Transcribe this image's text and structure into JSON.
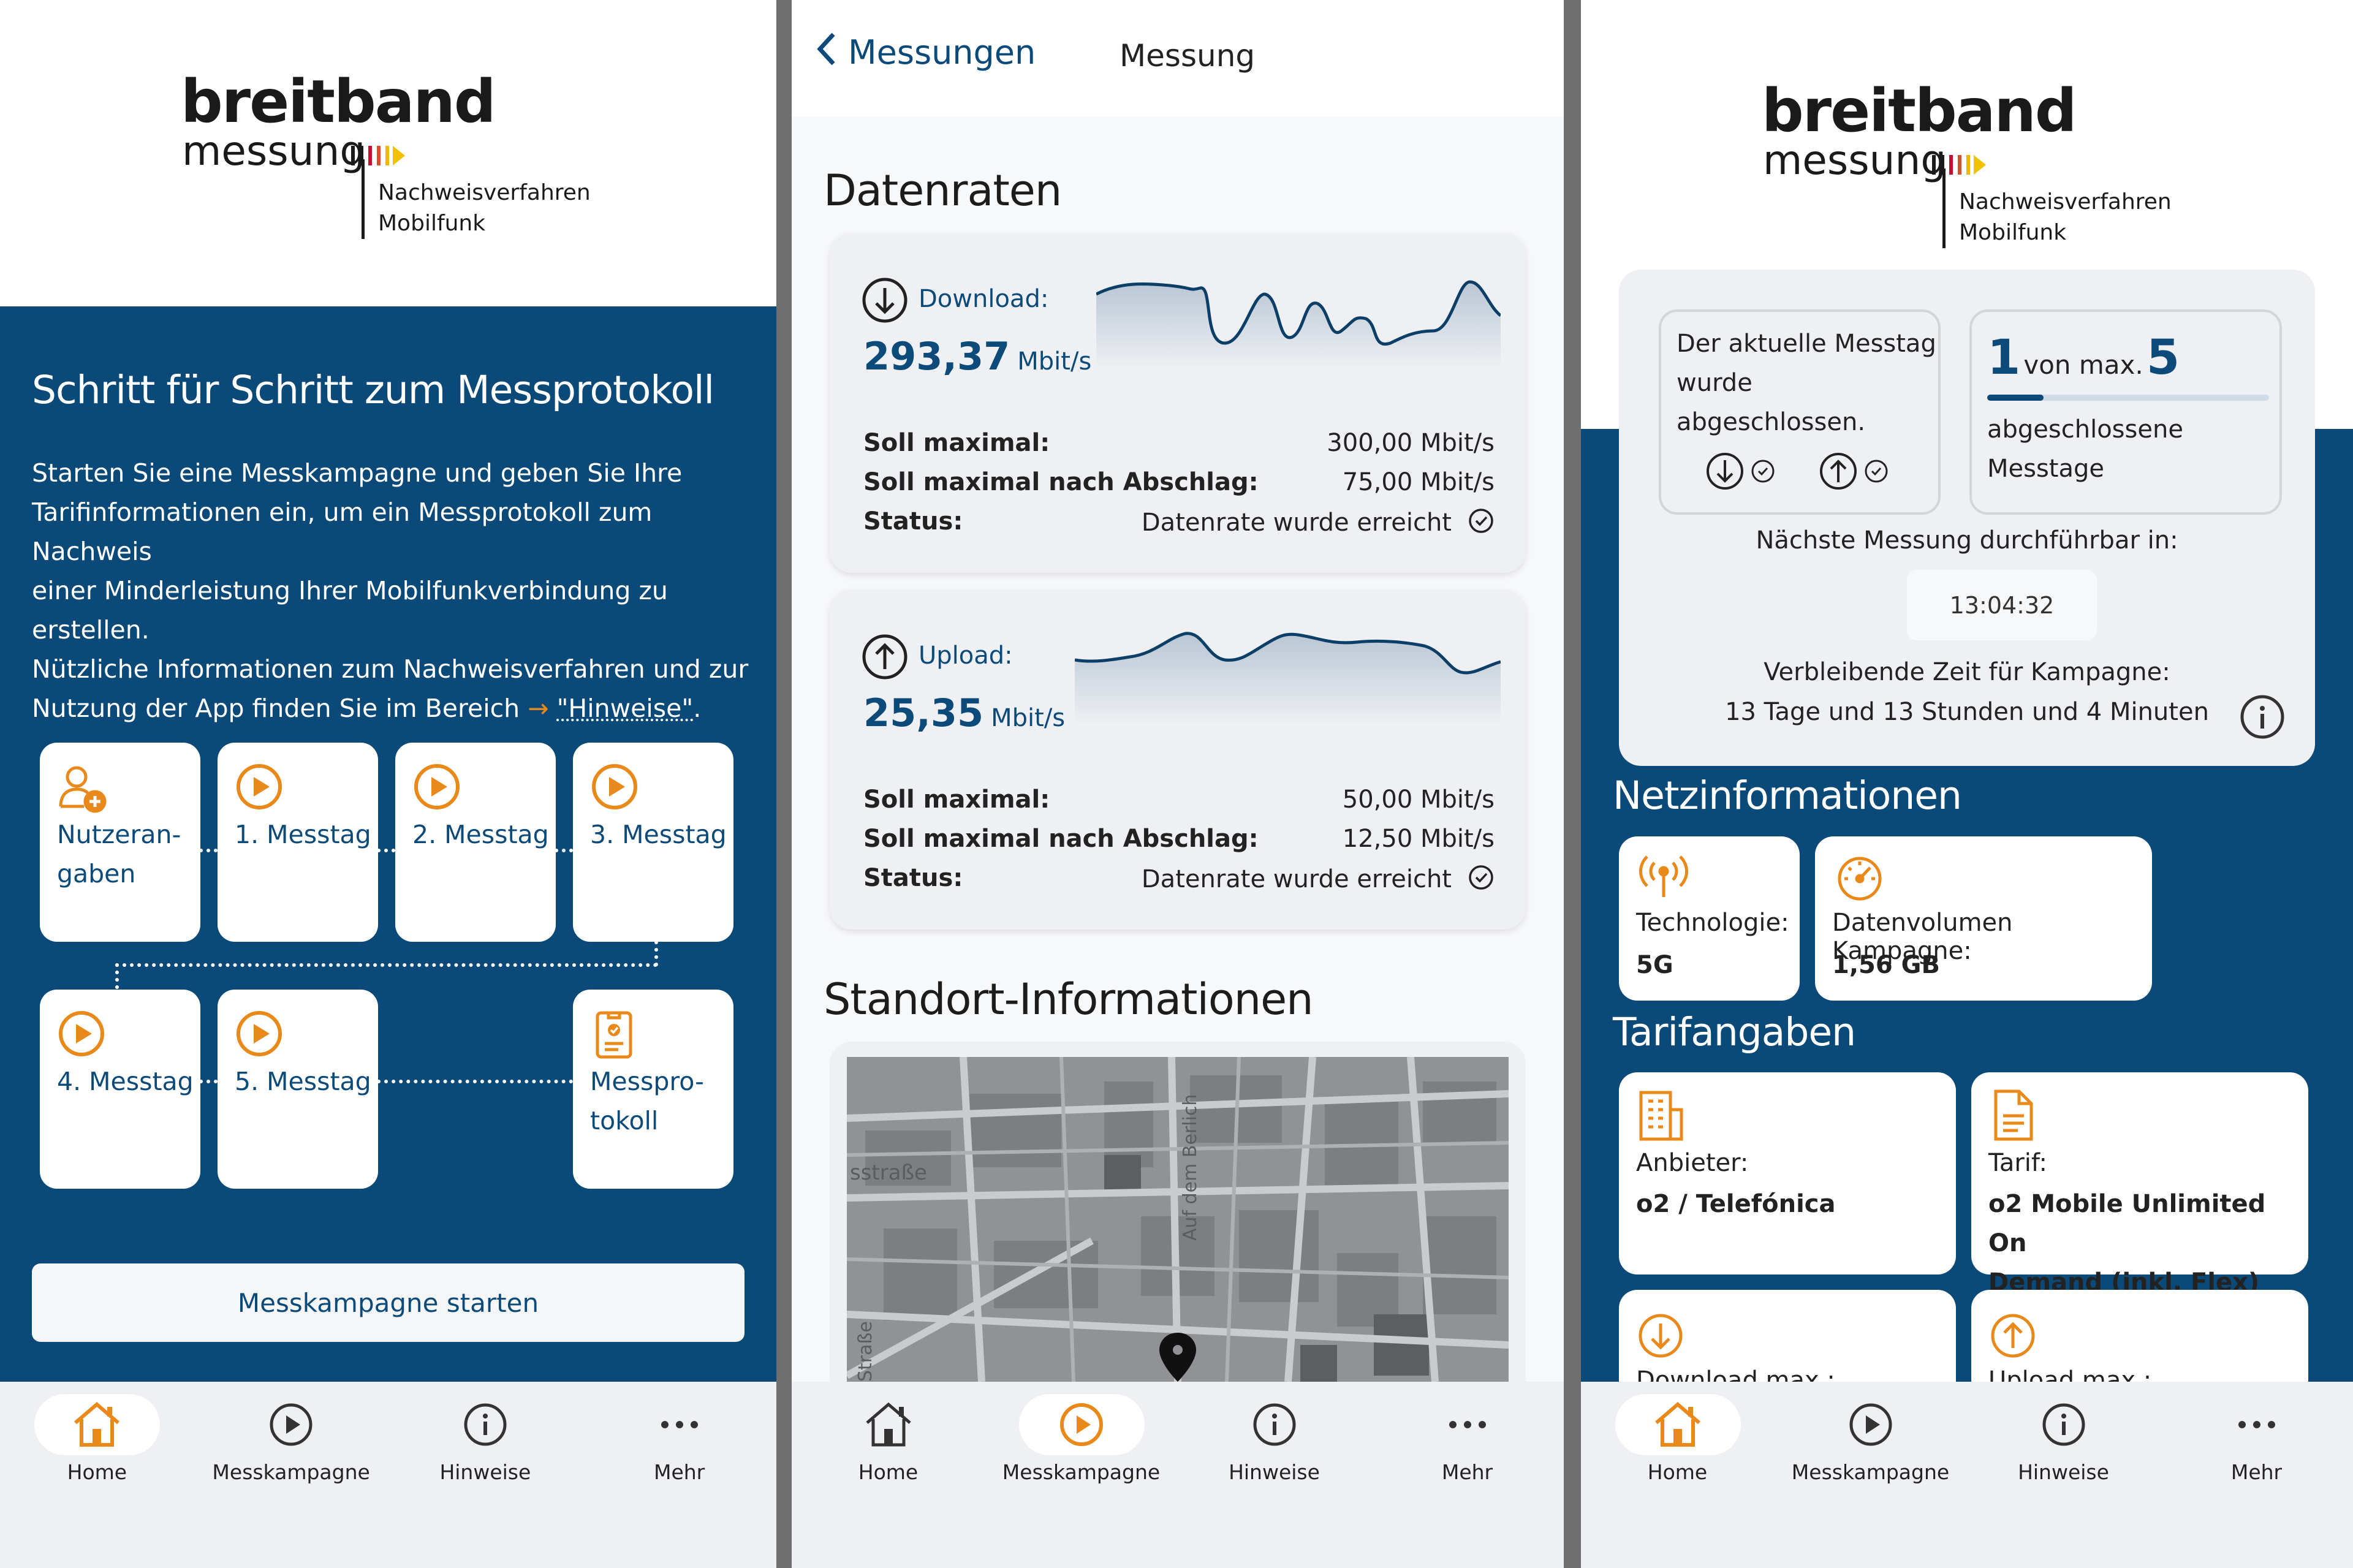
{
  "colors": {
    "navy": "#0b4a78",
    "accent_orange": "#e8891a",
    "card_gray": "#eef0f3"
  },
  "logo": {
    "word_top": "breitband",
    "word_bottom": "messung",
    "sub_line1": "Nachweisverfahren",
    "sub_line2": "Mobilfunk"
  },
  "screen1": {
    "title": "Schritt für Schritt zum Messprotokoll",
    "intro_lines": [
      "Starten Sie eine Messkampagne und geben Sie Ihre",
      "Tarifinformationen ein, um ein Messprotokoll zum Nachweis",
      "einer Minderleistung Ihrer Mobilfunkverbindung zu",
      "erstellen.",
      "Nützliche Informationen zum Nachweisverfahren und zur"
    ],
    "intro_last_prefix": "Nutzung der App finden Sie im Bereich ",
    "intro_arrow": "→",
    "intro_link": "\"Hinweise\"",
    "intro_last_suffix": ".",
    "steps": {
      "user_line1": "Nutzeran-",
      "user_line2": "gaben",
      "day1": "1. Messtag",
      "day2": "2. Messtag",
      "day3": "3. Messtag",
      "day4": "4. Messtag",
      "day5": "5. Messtag",
      "protocol_line1": "Messpro-",
      "protocol_line2": "tokoll"
    },
    "start_button": "Messkampagne starten"
  },
  "screen2": {
    "back_label": "Messungen",
    "header_title": "Messung",
    "section_rates": "Datenraten",
    "download": {
      "label": "Download:",
      "value": "293,37",
      "unit": "Mbit/s",
      "soll_max_label": "Soll maximal:",
      "soll_max_value": "300,00 Mbit/s",
      "soll_abschlag_label": "Soll maximal nach Abschlag:",
      "soll_abschlag_value": "75,00 Mbit/s",
      "status_label": "Status:",
      "status_value": "Datenrate wurde erreicht"
    },
    "upload": {
      "label": "Upload:",
      "value": "25,35",
      "unit": "Mbit/s",
      "soll_max_label": "Soll maximal:",
      "soll_max_value": "50,00 Mbit/s",
      "soll_abschlag_label": "Soll maximal nach Abschlag:",
      "soll_abschlag_value": "12,50 Mbit/s",
      "status_label": "Status:",
      "status_value": "Datenrate wurde erreicht"
    },
    "section_location": "Standort-Informationen",
    "map_labels": {
      "street1": "sstraße",
      "street2": "Auf dem Berlich",
      "street3": "Straße"
    }
  },
  "screen3": {
    "day_done_lines": [
      "Der aktuelle Messtag",
      "wurde",
      "abgeschlossen."
    ],
    "count_current": "1",
    "count_mid": "von max.",
    "count_max": "5",
    "count_progress": 0.2,
    "count_label_lines": [
      "abgeschlossene",
      "Messtage"
    ],
    "next_label": "Nächste Messung durchführbar in:",
    "next_time": "13:04:32",
    "remaining_label": "Verbleibende Zeit für Kampagne:",
    "remaining_value": "13 Tage und 13 Stunden und 4 Minuten",
    "net_title": "Netzinformationen",
    "tech_label": "Technologie:",
    "tech_value": "5G",
    "volume_label": "Datenvolumen Kampagne:",
    "volume_value": "1,56 GB",
    "tariff_title": "Tarifangaben",
    "provider_label": "Anbieter:",
    "provider_value": "o2 / Telefónica",
    "tariff_label": "Tarif:",
    "tariff_value_line1": "o2 Mobile Unlimited On",
    "tariff_value_line2": "Demand (inkl. Flex)",
    "download_max_label": "Download max.:",
    "upload_max_label": "Upload max.:"
  },
  "nav": {
    "home": "Home",
    "campaign": "Messkampagne",
    "hints": "Hinweise",
    "more": "Mehr"
  }
}
